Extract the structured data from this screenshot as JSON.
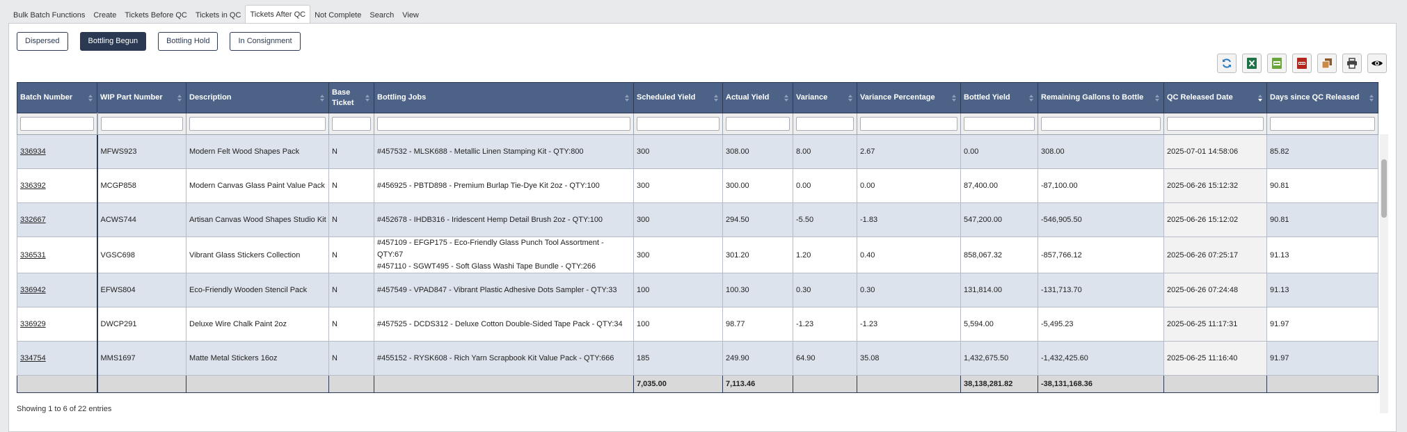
{
  "tabs": [
    {
      "label": "Bulk Batch Functions",
      "active": false
    },
    {
      "label": "Create",
      "active": false
    },
    {
      "label": "Tickets Before QC",
      "active": false
    },
    {
      "label": "Tickets in QC",
      "active": false
    },
    {
      "label": "Tickets After QC",
      "active": true
    },
    {
      "label": "Not Complete",
      "active": false
    },
    {
      "label": "Search",
      "active": false
    },
    {
      "label": "View",
      "active": false
    }
  ],
  "filters": [
    {
      "label": "Dispersed",
      "active": false
    },
    {
      "label": "Bottling Begun",
      "active": true
    },
    {
      "label": "Bottling Hold",
      "active": false
    },
    {
      "label": "In Consignment",
      "active": false
    }
  ],
  "toolbar": [
    {
      "icon": "refresh-icon",
      "color": "#2a7bbf"
    },
    {
      "icon": "excel-icon",
      "color": "#1e7145"
    },
    {
      "icon": "csv-icon",
      "color": "#6aa53a"
    },
    {
      "icon": "pdf-icon",
      "color": "#b3261e"
    },
    {
      "icon": "copy-icon",
      "color": "#8b5a2b"
    },
    {
      "icon": "print-icon",
      "color": "#444444"
    },
    {
      "icon": "eye-icon",
      "color": "#111111"
    }
  ],
  "columns": [
    "Batch Number",
    "WIP Part Number",
    "Description",
    "Base Ticket",
    "Bottling Jobs",
    "Scheduled Yield",
    "Actual Yield",
    "Variance",
    "Variance Percentage",
    "Bottled Yield",
    "Remaining Gallons to Bottle",
    "QC Released Date",
    "Days since QC Released"
  ],
  "rows": [
    {
      "batch": "336934",
      "wip": "MFWS923",
      "desc": "Modern Felt Wood Shapes Pack",
      "base": "N",
      "jobs": [
        "#457532 - MLSK688 - Metallic Linen Stamping Kit - QTY:800"
      ],
      "sched": "300",
      "actual": "308.00",
      "variance": "8.00",
      "varpct": "2.67",
      "bottled": "0.00",
      "remaining": "308.00",
      "qcdate": "2025-07-01 14:58:06",
      "days": "85.82"
    },
    {
      "batch": "336392",
      "wip": "MCGP858",
      "desc": "Modern Canvas Glass Paint Value Pack",
      "base": "N",
      "jobs": [
        "#456925 - PBTD898 - Premium Burlap Tie-Dye Kit 2oz - QTY:100"
      ],
      "sched": "300",
      "actual": "300.00",
      "variance": "0.00",
      "varpct": "0.00",
      "bottled": "87,400.00",
      "remaining": "-87,100.00",
      "qcdate": "2025-06-26 15:12:32",
      "days": "90.81"
    },
    {
      "batch": "332667",
      "wip": "ACWS744",
      "desc": "Artisan Canvas Wood Shapes Studio Kit",
      "base": "N",
      "jobs": [
        "#452678 - IHDB316 - Iridescent Hemp Detail Brush 2oz - QTY:100"
      ],
      "sched": "300",
      "actual": "294.50",
      "variance": "-5.50",
      "varpct": "-1.83",
      "bottled": "547,200.00",
      "remaining": "-546,905.50",
      "qcdate": "2025-06-26 15:12:02",
      "days": "90.81"
    },
    {
      "batch": "336531",
      "wip": "VGSC698",
      "desc": "Vibrant Glass Stickers Collection",
      "base": "N",
      "jobs": [
        "#457109 - EFGP175 - Eco-Friendly Glass Punch Tool Assortment - QTY:67",
        "#457110 - SGWT495 - Soft Glass Washi Tape Bundle - QTY:266"
      ],
      "sched": "300",
      "actual": "301.20",
      "variance": "1.20",
      "varpct": "0.40",
      "bottled": "858,067.32",
      "remaining": "-857,766.12",
      "qcdate": "2025-06-26 07:25:17",
      "days": "91.13"
    },
    {
      "batch": "336942",
      "wip": "EFWS804",
      "desc": "Eco-Friendly Wooden Stencil Pack",
      "base": "N",
      "jobs": [
        "#457549 - VPAD847 - Vibrant Plastic Adhesive Dots Sampler - QTY:33"
      ],
      "sched": "100",
      "actual": "100.30",
      "variance": "0.30",
      "varpct": "0.30",
      "bottled": "131,814.00",
      "remaining": "-131,713.70",
      "qcdate": "2025-06-26 07:24:48",
      "days": "91.13"
    },
    {
      "batch": "336929",
      "wip": "DWCP291",
      "desc": "Deluxe Wire Chalk Paint 2oz",
      "base": "N",
      "jobs": [
        "#457525 - DCDS312 - Deluxe Cotton Double-Sided Tape Pack - QTY:34"
      ],
      "sched": "100",
      "actual": "98.77",
      "variance": "-1.23",
      "varpct": "-1.23",
      "bottled": "5,594.00",
      "remaining": "-5,495.23",
      "qcdate": "2025-06-25 11:17:31",
      "days": "91.97"
    },
    {
      "batch": "334754",
      "wip": "MMS1697",
      "desc": "Matte Metal Stickers 16oz",
      "base": "N",
      "jobs": [
        "#455152 - RYSK608 - Rich Yarn Scrapbook Kit Value Pack - QTY:666"
      ],
      "sched": "185",
      "actual": "249.90",
      "variance": "64.90",
      "varpct": "35.08",
      "bottled": "1,432,675.50",
      "remaining": "-1,432,425.60",
      "qcdate": "2025-06-25 11:16:40",
      "days": "91.97"
    }
  ],
  "totals": {
    "sched": "7,035.00",
    "actual": "7,113.46",
    "bottled": "38,138,281.82",
    "remaining": "-38,131,168.36"
  },
  "info": "Showing 1 to 6 of 22 entries",
  "scroll": {
    "position": 0.09,
    "visible": 0.21
  }
}
